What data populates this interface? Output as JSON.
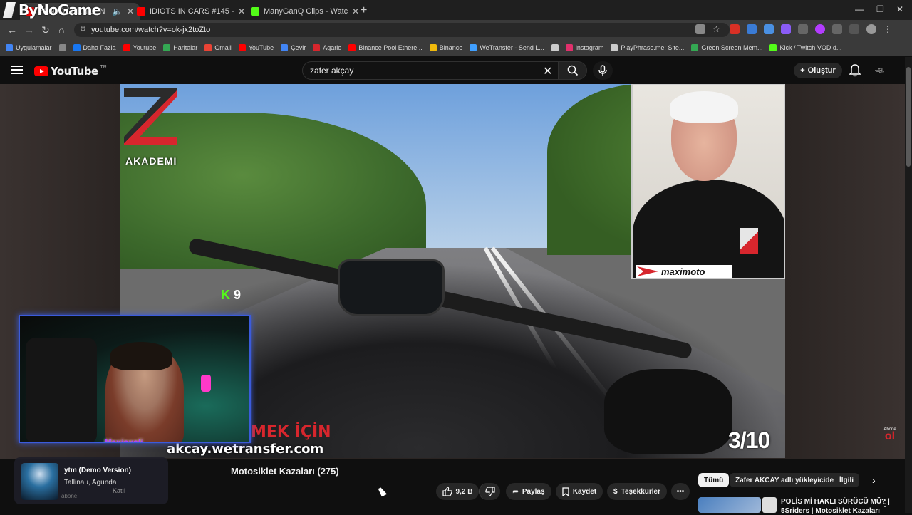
{
  "brand": {
    "name": "ByNoGame"
  },
  "tabs": [
    {
      "label": "YENİ ÖĞRENİLEN 5Sriders |",
      "active": true,
      "icon": "youtube-icon",
      "color": "#ff0000",
      "audio": true
    },
    {
      "label": "IDIOTS IN CARS #145 - YouTube",
      "active": false,
      "icon": "youtube-icon",
      "color": "#ff0000"
    },
    {
      "label": "ManyGanQ Clips - Watch Live o...",
      "active": false,
      "icon": "kick-icon",
      "color": "#53fc18"
    }
  ],
  "address": {
    "url": "youtube.com/watch?v=ok-jx2toZto"
  },
  "bookmarks": [
    {
      "label": "Uygulamalar",
      "color": "#4285f4"
    },
    {
      "label": "",
      "color": "#888888"
    },
    {
      "label": "Daha Fazla",
      "color": "#1877f2"
    },
    {
      "label": "Youtube",
      "color": "#ff0000"
    },
    {
      "label": "Haritalar",
      "color": "#34a853"
    },
    {
      "label": "Gmail",
      "color": "#ea4335"
    },
    {
      "label": "YouTube",
      "color": "#ff0000"
    },
    {
      "label": "Çevir",
      "color": "#4285f4"
    },
    {
      "label": "Agario",
      "color": "#d7262d"
    },
    {
      "label": "Binance Pool Ethere...",
      "color": "#ff0000"
    },
    {
      "label": "Binance",
      "color": "#f0b90b"
    },
    {
      "label": "WeTransfer - Send L...",
      "color": "#409fff"
    },
    {
      "label": "",
      "color": "#cccccc"
    },
    {
      "label": "instagram",
      "color": "#e1306c"
    },
    {
      "label": "PlayPhrase.me: Site...",
      "color": "#cccccc"
    },
    {
      "label": "Green Screen Mem...",
      "color": "#34a853"
    },
    {
      "label": "Kick / Twitch VOD d...",
      "color": "#53fc18"
    }
  ],
  "youtube": {
    "logo": "YouTube",
    "region": "TR",
    "search_query": "zafer akçay",
    "create_label": "Oluştur"
  },
  "video": {
    "overlay_logo_text": "AKADEMI",
    "kick_badge": "K",
    "kick_number": "9",
    "counter": "3/10",
    "overlay_line1": "MEK İÇİN",
    "overlay_line2": "akcay.wetransfer.com",
    "facecam_brand": "maximoto",
    "streamer_name": "Maxioxali",
    "abone_top": "Abone",
    "abone_bottom": "ol"
  },
  "below": {
    "title": "Motosiklet Kazaları (275)",
    "music_title": "ytm (Demo Version)",
    "music_artist": "Tallinau, Agunda",
    "channel_ghost": "AKCAY",
    "join_ghost": "Katıl",
    "subs_ghost": "abone",
    "likes": "9,2 B",
    "share": "Paylaş",
    "save": "Kaydet",
    "thanks": "Teşekkürler"
  },
  "chips": [
    {
      "label": "Tümü",
      "active": true
    },
    {
      "label": "Zafer AKCAY adlı yükleyiciden",
      "active": false
    },
    {
      "label": "İlgili",
      "active": false
    }
  ],
  "recommendation": {
    "title": "POLİS Mİ HAKLI SÜRÜCÜ MÜ? |",
    "subtitle": "5Sriders | Motosiklet Kazaları"
  }
}
